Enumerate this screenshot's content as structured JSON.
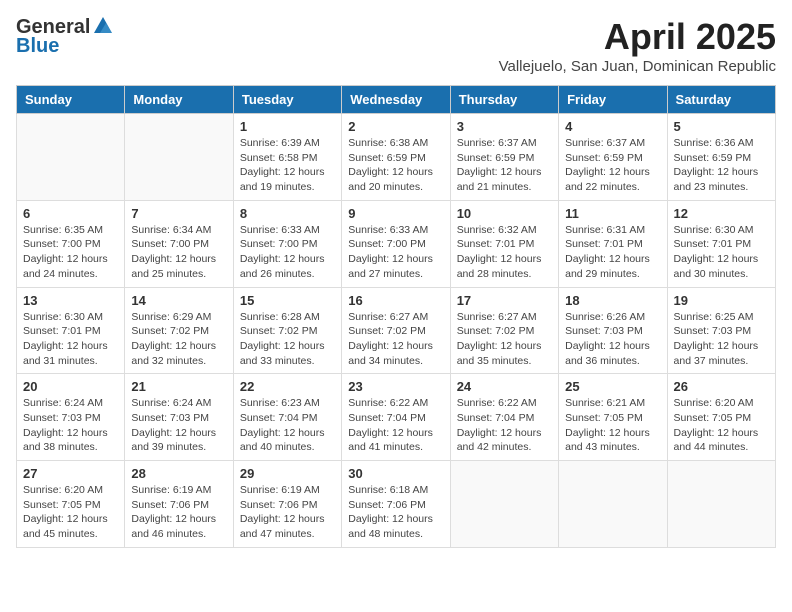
{
  "header": {
    "logo_general": "General",
    "logo_blue": "Blue",
    "month_year": "April 2025",
    "location": "Vallejuelo, San Juan, Dominican Republic"
  },
  "days_of_week": [
    "Sunday",
    "Monday",
    "Tuesday",
    "Wednesday",
    "Thursday",
    "Friday",
    "Saturday"
  ],
  "weeks": [
    [
      {
        "day": "",
        "info": ""
      },
      {
        "day": "",
        "info": ""
      },
      {
        "day": "1",
        "info": "Sunrise: 6:39 AM\nSunset: 6:58 PM\nDaylight: 12 hours and 19 minutes."
      },
      {
        "day": "2",
        "info": "Sunrise: 6:38 AM\nSunset: 6:59 PM\nDaylight: 12 hours and 20 minutes."
      },
      {
        "day": "3",
        "info": "Sunrise: 6:37 AM\nSunset: 6:59 PM\nDaylight: 12 hours and 21 minutes."
      },
      {
        "day": "4",
        "info": "Sunrise: 6:37 AM\nSunset: 6:59 PM\nDaylight: 12 hours and 22 minutes."
      },
      {
        "day": "5",
        "info": "Sunrise: 6:36 AM\nSunset: 6:59 PM\nDaylight: 12 hours and 23 minutes."
      }
    ],
    [
      {
        "day": "6",
        "info": "Sunrise: 6:35 AM\nSunset: 7:00 PM\nDaylight: 12 hours and 24 minutes."
      },
      {
        "day": "7",
        "info": "Sunrise: 6:34 AM\nSunset: 7:00 PM\nDaylight: 12 hours and 25 minutes."
      },
      {
        "day": "8",
        "info": "Sunrise: 6:33 AM\nSunset: 7:00 PM\nDaylight: 12 hours and 26 minutes."
      },
      {
        "day": "9",
        "info": "Sunrise: 6:33 AM\nSunset: 7:00 PM\nDaylight: 12 hours and 27 minutes."
      },
      {
        "day": "10",
        "info": "Sunrise: 6:32 AM\nSunset: 7:01 PM\nDaylight: 12 hours and 28 minutes."
      },
      {
        "day": "11",
        "info": "Sunrise: 6:31 AM\nSunset: 7:01 PM\nDaylight: 12 hours and 29 minutes."
      },
      {
        "day": "12",
        "info": "Sunrise: 6:30 AM\nSunset: 7:01 PM\nDaylight: 12 hours and 30 minutes."
      }
    ],
    [
      {
        "day": "13",
        "info": "Sunrise: 6:30 AM\nSunset: 7:01 PM\nDaylight: 12 hours and 31 minutes."
      },
      {
        "day": "14",
        "info": "Sunrise: 6:29 AM\nSunset: 7:02 PM\nDaylight: 12 hours and 32 minutes."
      },
      {
        "day": "15",
        "info": "Sunrise: 6:28 AM\nSunset: 7:02 PM\nDaylight: 12 hours and 33 minutes."
      },
      {
        "day": "16",
        "info": "Sunrise: 6:27 AM\nSunset: 7:02 PM\nDaylight: 12 hours and 34 minutes."
      },
      {
        "day": "17",
        "info": "Sunrise: 6:27 AM\nSunset: 7:02 PM\nDaylight: 12 hours and 35 minutes."
      },
      {
        "day": "18",
        "info": "Sunrise: 6:26 AM\nSunset: 7:03 PM\nDaylight: 12 hours and 36 minutes."
      },
      {
        "day": "19",
        "info": "Sunrise: 6:25 AM\nSunset: 7:03 PM\nDaylight: 12 hours and 37 minutes."
      }
    ],
    [
      {
        "day": "20",
        "info": "Sunrise: 6:24 AM\nSunset: 7:03 PM\nDaylight: 12 hours and 38 minutes."
      },
      {
        "day": "21",
        "info": "Sunrise: 6:24 AM\nSunset: 7:03 PM\nDaylight: 12 hours and 39 minutes."
      },
      {
        "day": "22",
        "info": "Sunrise: 6:23 AM\nSunset: 7:04 PM\nDaylight: 12 hours and 40 minutes."
      },
      {
        "day": "23",
        "info": "Sunrise: 6:22 AM\nSunset: 7:04 PM\nDaylight: 12 hours and 41 minutes."
      },
      {
        "day": "24",
        "info": "Sunrise: 6:22 AM\nSunset: 7:04 PM\nDaylight: 12 hours and 42 minutes."
      },
      {
        "day": "25",
        "info": "Sunrise: 6:21 AM\nSunset: 7:05 PM\nDaylight: 12 hours and 43 minutes."
      },
      {
        "day": "26",
        "info": "Sunrise: 6:20 AM\nSunset: 7:05 PM\nDaylight: 12 hours and 44 minutes."
      }
    ],
    [
      {
        "day": "27",
        "info": "Sunrise: 6:20 AM\nSunset: 7:05 PM\nDaylight: 12 hours and 45 minutes."
      },
      {
        "day": "28",
        "info": "Sunrise: 6:19 AM\nSunset: 7:06 PM\nDaylight: 12 hours and 46 minutes."
      },
      {
        "day": "29",
        "info": "Sunrise: 6:19 AM\nSunset: 7:06 PM\nDaylight: 12 hours and 47 minutes."
      },
      {
        "day": "30",
        "info": "Sunrise: 6:18 AM\nSunset: 7:06 PM\nDaylight: 12 hours and 48 minutes."
      },
      {
        "day": "",
        "info": ""
      },
      {
        "day": "",
        "info": ""
      },
      {
        "day": "",
        "info": ""
      }
    ]
  ]
}
